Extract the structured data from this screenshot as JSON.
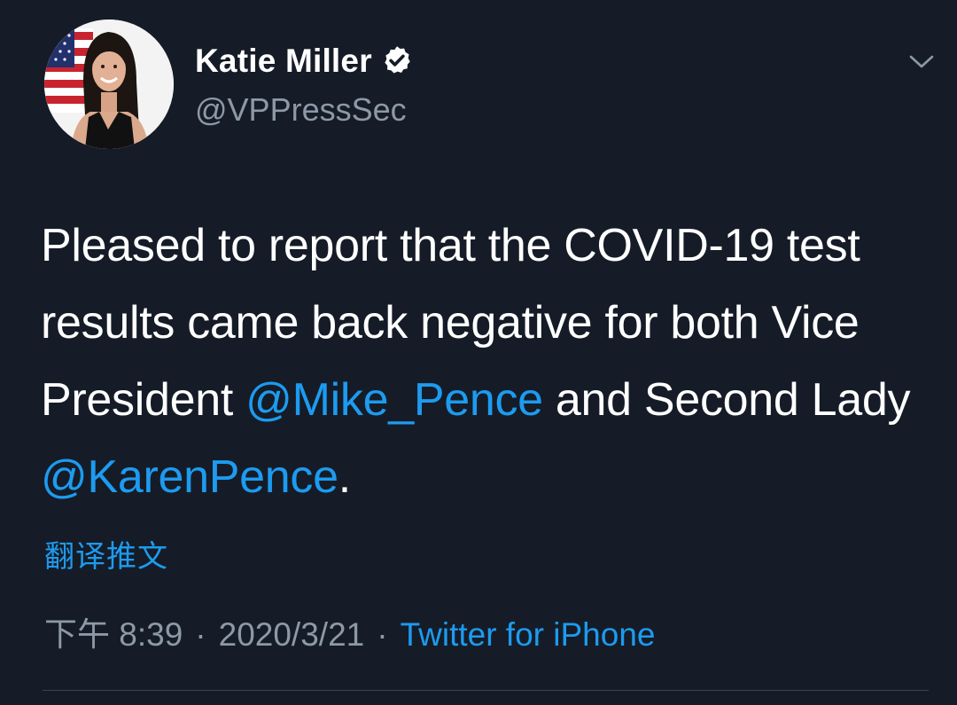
{
  "author": {
    "display_name": "Katie Miller",
    "handle": "@VPPressSec",
    "verified": true
  },
  "tweet": {
    "text_parts": {
      "p1": "Pleased to report that the COVID-19 test results came back negative for both Vice President ",
      "mention1": "@Mike_Pence",
      "p2": " and Second Lady ",
      "mention2": "@KarenPence",
      "p3": "."
    },
    "translate_label": "翻译推文"
  },
  "meta": {
    "time": "下午 8:39",
    "date": "2020/3/21",
    "separator": "·",
    "source": "Twitter for iPhone"
  },
  "icons": {
    "verified": "verified-badge-icon",
    "more": "chevron-down-icon"
  },
  "colors": {
    "background": "#151c27",
    "text": "#ffffff",
    "secondary_text": "#8d99a6",
    "accent": "#1d9bf0"
  }
}
